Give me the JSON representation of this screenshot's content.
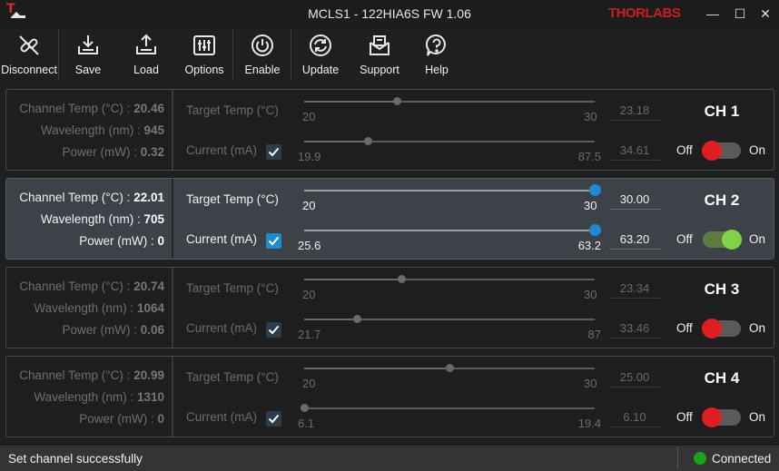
{
  "app": {
    "title": "MCLS1 - 122HIA6S FW 1.06",
    "logo_letter": "T",
    "brand": "THORLABS",
    "window_controls": {
      "minimize": "—",
      "maximize": "☐",
      "close": "✕"
    }
  },
  "toolbar": {
    "disconnect": "Disconnect",
    "save": "Save",
    "load": "Load",
    "options": "Options",
    "enable": "Enable",
    "update": "Update",
    "support": "Support",
    "help": "Help"
  },
  "labels": {
    "channel_temp": "Channel Temp (°C) :",
    "wavelength": "Wavelength (nm) :",
    "power": "Power (mW) :",
    "target_temp": "Target Temp (°C)",
    "current": "Current (mA)",
    "off": "Off",
    "on": "On"
  },
  "channels": [
    {
      "name": "CH 1",
      "active": false,
      "enabled": false,
      "channel_temp": "20.46",
      "wavelength": "945",
      "power": "0.32",
      "temp_min": "20",
      "temp_max": "30",
      "temp_value": "23.18",
      "temp_fraction": 0.318,
      "current_min": "19.9",
      "current_max": "87.5",
      "current_value": "34.61",
      "current_fraction": 0.218,
      "current_checked": true
    },
    {
      "name": "CH 2",
      "active": true,
      "enabled": true,
      "channel_temp": "22.01",
      "wavelength": "705",
      "power": "0",
      "temp_min": "20",
      "temp_max": "30",
      "temp_value": "30.00",
      "temp_fraction": 1.0,
      "current_min": "25.6",
      "current_max": "63.2",
      "current_value": "63.20",
      "current_fraction": 1.0,
      "current_checked": true
    },
    {
      "name": "CH 3",
      "active": false,
      "enabled": false,
      "channel_temp": "20.74",
      "wavelength": "1064",
      "power": "0.06",
      "temp_min": "20",
      "temp_max": "30",
      "temp_value": "23.34",
      "temp_fraction": 0.334,
      "current_min": "21.7",
      "current_max": "87",
      "current_value": "33.46",
      "current_fraction": 0.18,
      "current_checked": true
    },
    {
      "name": "CH 4",
      "active": false,
      "enabled": false,
      "channel_temp": "20.99",
      "wavelength": "1310",
      "power": "0",
      "temp_min": "20",
      "temp_max": "30",
      "temp_value": "25.00",
      "temp_fraction": 0.5,
      "current_min": "6.1",
      "current_max": "19.4",
      "current_value": "6.10",
      "current_fraction": 0.0,
      "current_checked": true
    }
  ],
  "status": {
    "message": "Set channel successfully",
    "connection": "Connected",
    "connection_color": "#19a31d"
  }
}
